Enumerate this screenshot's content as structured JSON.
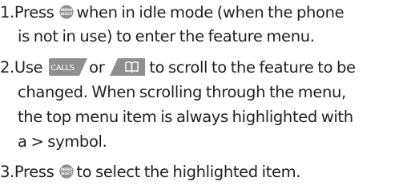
{
  "steps": [
    {
      "number": "1.",
      "before_icon": "Press",
      "icon": "menu-select-key-icon",
      "after_icon": "when in idle mode (when the phone",
      "continuation": [
        "is not in use) to enter the feature menu."
      ]
    },
    {
      "number": "2.",
      "before_icon": "Use",
      "icon_1": "calls-key-icon",
      "icon_1_label": "CALLS",
      "between_icons": "or",
      "icon_2": "phonebook-key-icon",
      "after_icons": "to scroll to the feature to be",
      "continuation": [
        "changed. When scrolling through the menu,",
        "the top menu item is always highlighted with",
        "a > symbol."
      ]
    },
    {
      "number": "3.",
      "before_icon": "Press",
      "icon": "menu-select-key-icon",
      "after_icon": "to select the highlighted item."
    }
  ],
  "menu_key_label_top": "MENU",
  "menu_key_label_bottom": "SELECT",
  "colors": {
    "text": "#231f20",
    "key_fill": "#8f8f8f",
    "key_text": "#ffffff"
  }
}
